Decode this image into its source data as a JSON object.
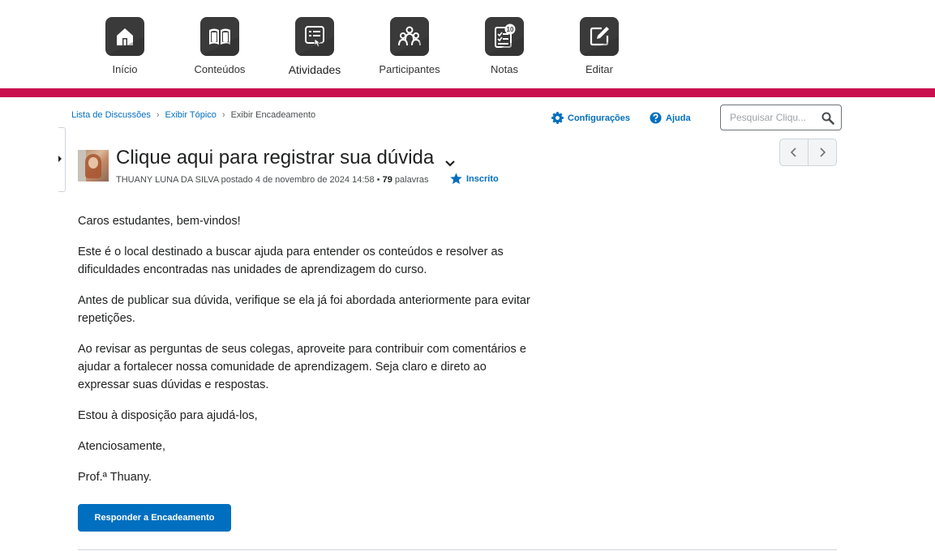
{
  "nav": {
    "items": [
      {
        "label": "Início"
      },
      {
        "label": "Conteúdos"
      },
      {
        "label": "Atividades"
      },
      {
        "label": "Participantes"
      },
      {
        "label": "Notas"
      },
      {
        "label": "Editar"
      }
    ],
    "badge": "10",
    "accent_color": "#c8104e"
  },
  "breadcrumb": {
    "items": [
      "Lista de Discussões",
      "Exibir Tópico"
    ],
    "current": "Exibir Encadeamento",
    "separator": "›"
  },
  "tools": {
    "settings_label": "Configurações",
    "help_label": "Ajuda"
  },
  "search": {
    "placeholder": "Pesquisar Cliqu..."
  },
  "thread": {
    "title": "Clique aqui para registrar sua dúvida",
    "author": "THUANY LUNA DA SILVA",
    "posted_text": "postado 4 de novembro de 2024 14:58",
    "bullet": "•",
    "word_count": "79",
    "words_label": "palavras",
    "subscribed_label": "Inscrito"
  },
  "post": {
    "paragraphs": [
      "Caros estudantes, bem-vindos!",
      "Este é o local destinado a buscar ajuda para entender os conteúdos e resolver as dificuldades encontradas nas unidades de aprendizagem do curso.",
      "Antes de publicar sua dúvida, verifique se ela já foi abordada anteriormente para evitar repetições.",
      "Ao revisar as perguntas de seus colegas, aproveite para contribuir com comentários e ajudar a fortalecer nossa comunidade de aprendizagem. Seja claro e direto ao expressar suas dúvidas e respostas.",
      "Estou à disposição para ajudá-los,",
      "Atenciosamente,",
      "Prof.ª Thuany."
    ]
  },
  "actions": {
    "reply_label": "Responder a Encadeamento"
  },
  "colors": {
    "link": "#006fbf",
    "primary_button": "#006fbf"
  }
}
